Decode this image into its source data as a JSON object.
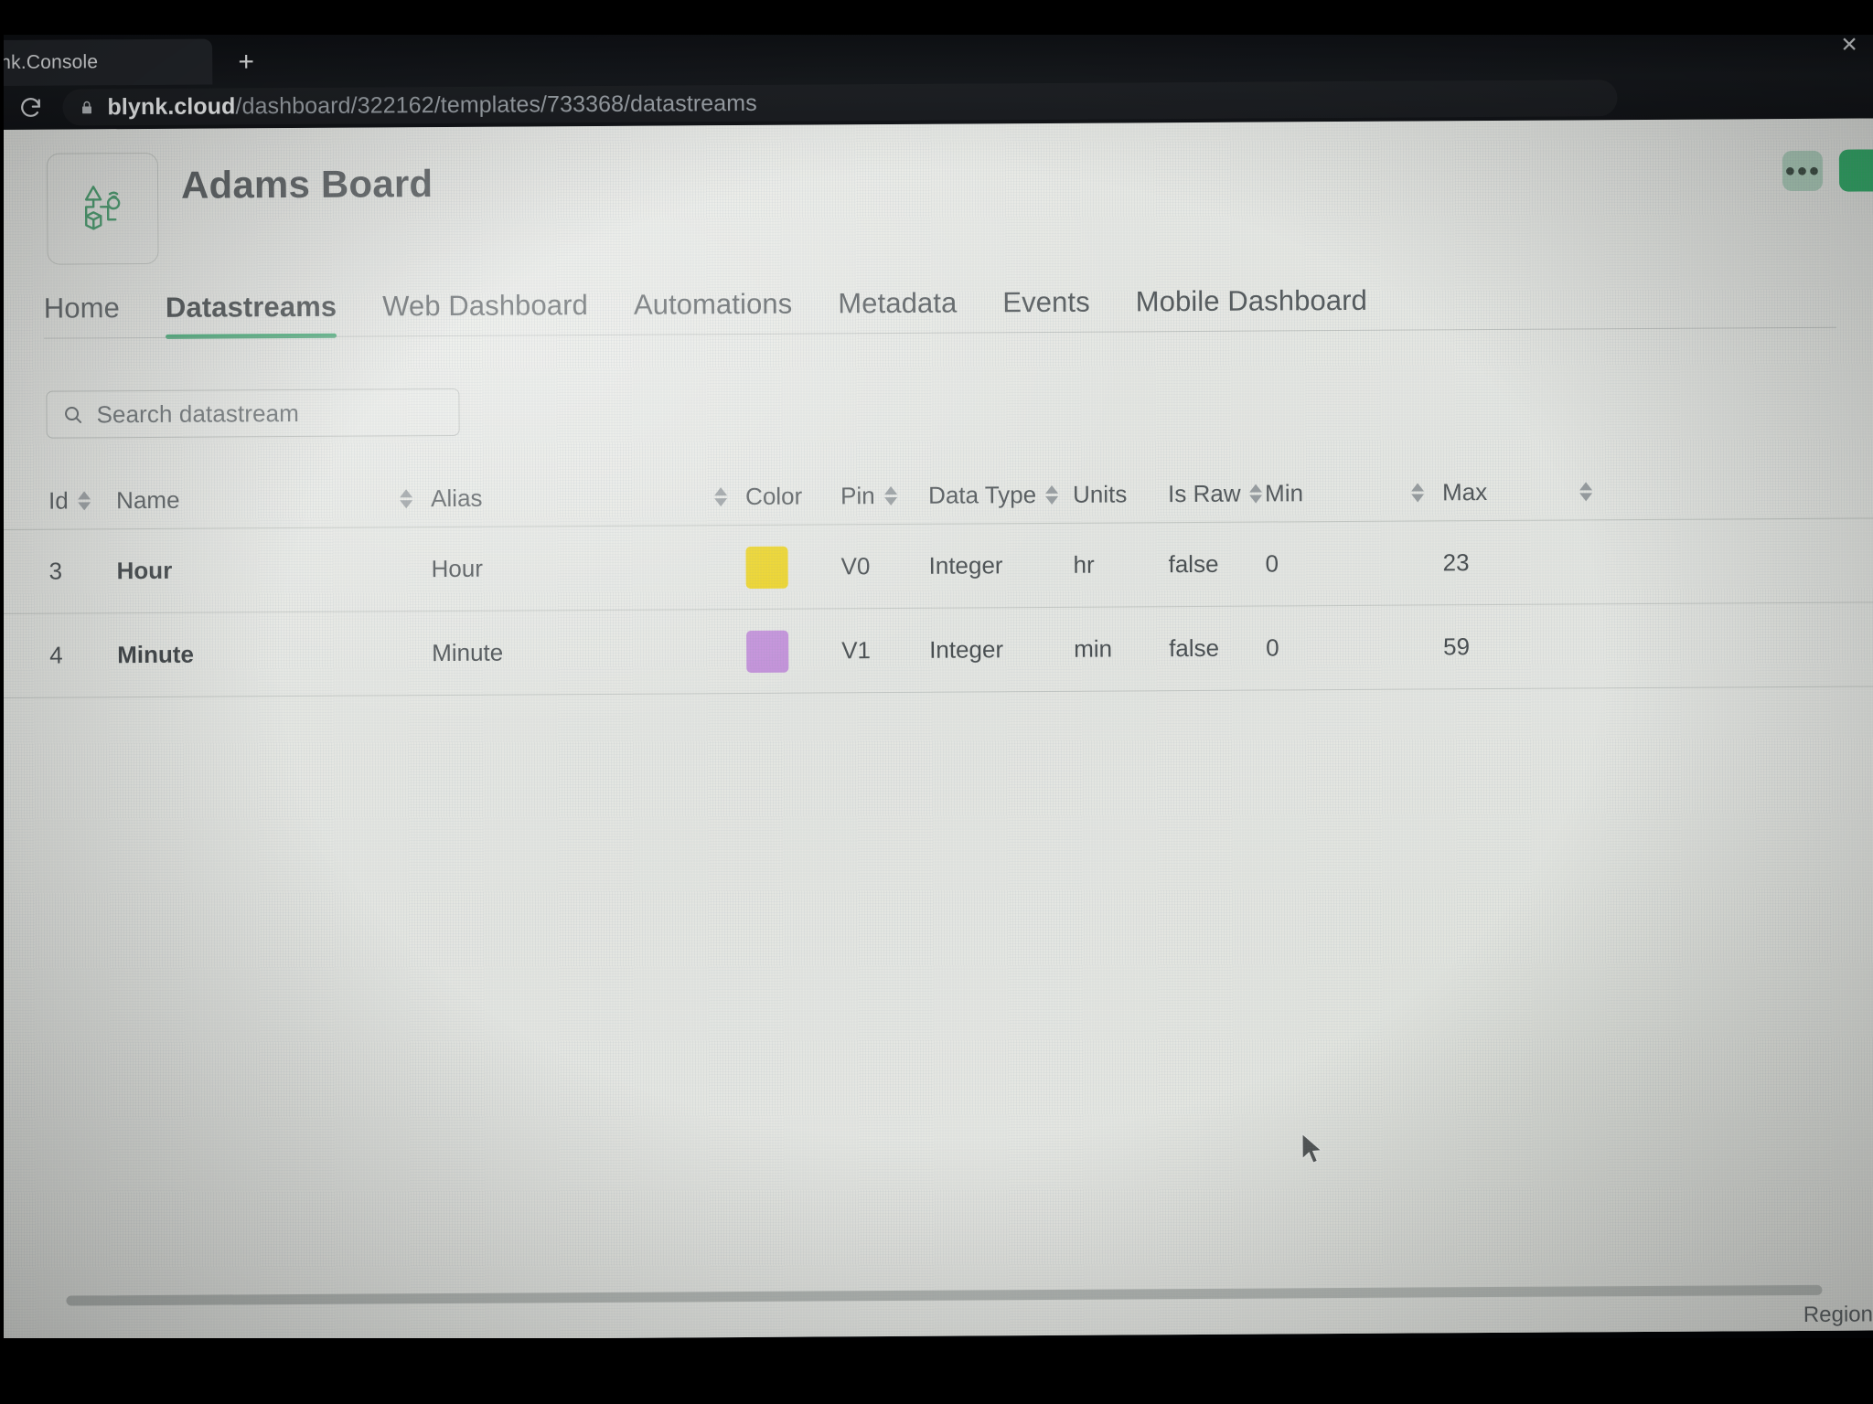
{
  "browser": {
    "tab_title": "nk.Console",
    "close_icon": "close-icon",
    "new_tab_icon": "plus-icon",
    "reload_icon": "reload-icon",
    "lock_icon": "lock-icon",
    "url_domain": "blynk.cloud",
    "url_path": "/dashboard/322162/templates/733368/datastreams",
    "actions": [
      "share-icon",
      "bookmark-star-icon",
      "extensions-puzzle-icon",
      "profile-icon"
    ],
    "accent": "#1fa463"
  },
  "header": {
    "title": "Adams Board",
    "logo_icon": "iot-device-icon",
    "more_button_label": "●●●",
    "more_button_color": "#a8cdb8",
    "save_button_color": "#15a556"
  },
  "nav": {
    "items": [
      {
        "label": "Home",
        "active": false
      },
      {
        "label": "Datastreams",
        "active": true
      },
      {
        "label": "Web Dashboard",
        "active": false
      },
      {
        "label": "Automations",
        "active": false
      },
      {
        "label": "Metadata",
        "active": false
      },
      {
        "label": "Events",
        "active": false
      },
      {
        "label": "Mobile Dashboard",
        "active": false
      }
    ],
    "active_underline_color": "#1f9f5d"
  },
  "search": {
    "placeholder": "Search datastream",
    "value": "",
    "icon": "search-icon"
  },
  "table": {
    "columns": [
      {
        "key": "id",
        "label": "Id",
        "sortable": true,
        "filterable": false
      },
      {
        "key": "name",
        "label": "Name",
        "sortable": true,
        "filterable": false
      },
      {
        "key": "alias",
        "label": "Alias",
        "sortable": true,
        "filterable": false
      },
      {
        "key": "color",
        "label": "Color",
        "sortable": false,
        "filterable": false
      },
      {
        "key": "pin",
        "label": "Pin",
        "sortable": true,
        "filterable": false
      },
      {
        "key": "type",
        "label": "Data Type",
        "sortable": true,
        "filterable": true
      },
      {
        "key": "units",
        "label": "Units",
        "sortable": false,
        "filterable": false
      },
      {
        "key": "raw",
        "label": "Is Raw",
        "sortable": true,
        "filterable": false
      },
      {
        "key": "min",
        "label": "Min",
        "sortable": true,
        "filterable": false
      },
      {
        "key": "max",
        "label": "Max",
        "sortable": true,
        "filterable": false
      }
    ],
    "rows": [
      {
        "id": "3",
        "name": "Hour",
        "alias": "Hour",
        "color": "#F2D300",
        "pin": "V0",
        "type": "Integer",
        "units": "hr",
        "raw": "false",
        "min": "0",
        "max": "23"
      },
      {
        "id": "4",
        "name": "Minute",
        "alias": "Minute",
        "color": "#C184DC",
        "pin": "V1",
        "type": "Integer",
        "units": "min",
        "raw": "false",
        "min": "0",
        "max": "59"
      }
    ]
  },
  "footer": {
    "region_label": "Region:"
  }
}
